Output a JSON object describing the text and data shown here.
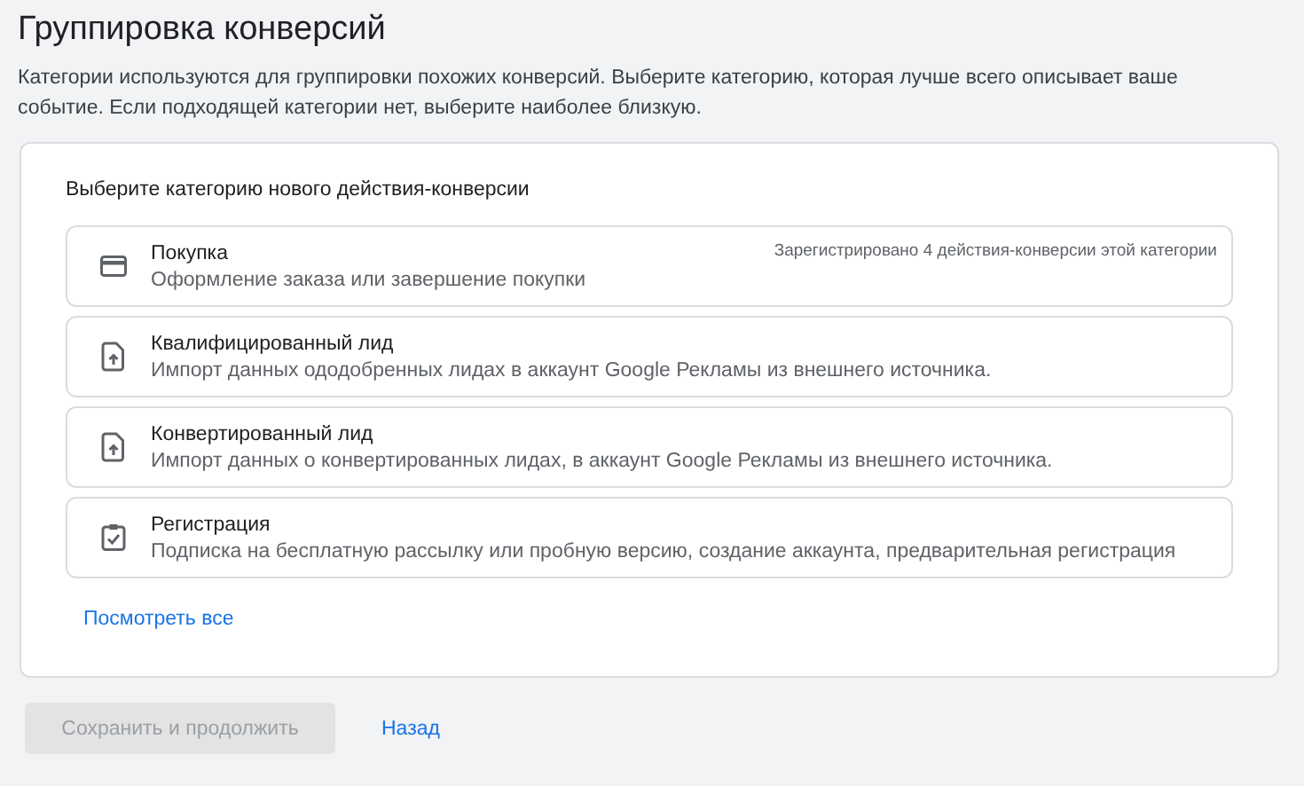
{
  "title": "Группировка конверсий",
  "description": "Категории используются для группировки похожих конверсий. Выберите категорию, которая лучше всего описывает ваше событие. Если подходящей категории нет, выберите наиболее близкую.",
  "card": {
    "heading": "Выберите категорию нового действия-конверсии",
    "options": [
      {
        "kind": "payment",
        "title": "Покупка",
        "subtitle": "Оформление заказа или завершение покупки",
        "note": "Зарегистрировано 4 действия-конверсии этой категории"
      },
      {
        "kind": "import",
        "title": "Квалифицированный лид",
        "subtitle": "Импорт данных ододобренных лидах в аккаунт Google Рекламы из внешнего источника."
      },
      {
        "kind": "import",
        "title": "Конвертированный лид",
        "subtitle": "Импорт данных о конвертированных лидах, в аккаунт Google Рекламы из внешнего источника."
      },
      {
        "kind": "form",
        "title": "Регистрация",
        "subtitle": "Подписка на бесплатную рассылку или пробную версию, создание аккаунта, предварительная регистрация"
      }
    ],
    "see_all": "Посмотреть все"
  },
  "buttons": {
    "save": {
      "label": "Сохранить и продолжить",
      "disabled": true
    },
    "back": {
      "label": "Назад"
    }
  }
}
